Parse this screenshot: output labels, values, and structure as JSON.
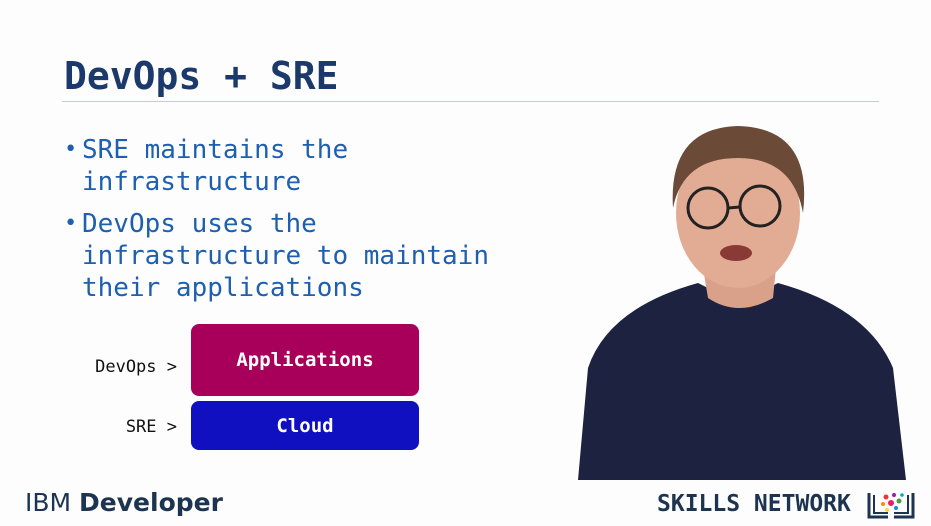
{
  "slide": {
    "title": "DevOps + SRE",
    "bullets": [
      {
        "lines": [
          "SRE maintains the",
          "infrastructure"
        ]
      },
      {
        "lines": [
          "DevOps uses the",
          "infrastructure to maintain",
          "their applications"
        ]
      }
    ],
    "diagram": {
      "rows": [
        {
          "label": "DevOps >",
          "box": "Applications",
          "color": "#a8005a"
        },
        {
          "label": "SRE >",
          "box": "Cloud",
          "color": "#1010c0"
        }
      ]
    }
  },
  "footer": {
    "brand_light": "IBM",
    "brand_bold": "Developer",
    "skills_network": "SKILLS NETWORK"
  },
  "colors": {
    "title": "#1b3a6b",
    "bullet": "#1f5fb0",
    "footer": "#1d3450"
  }
}
